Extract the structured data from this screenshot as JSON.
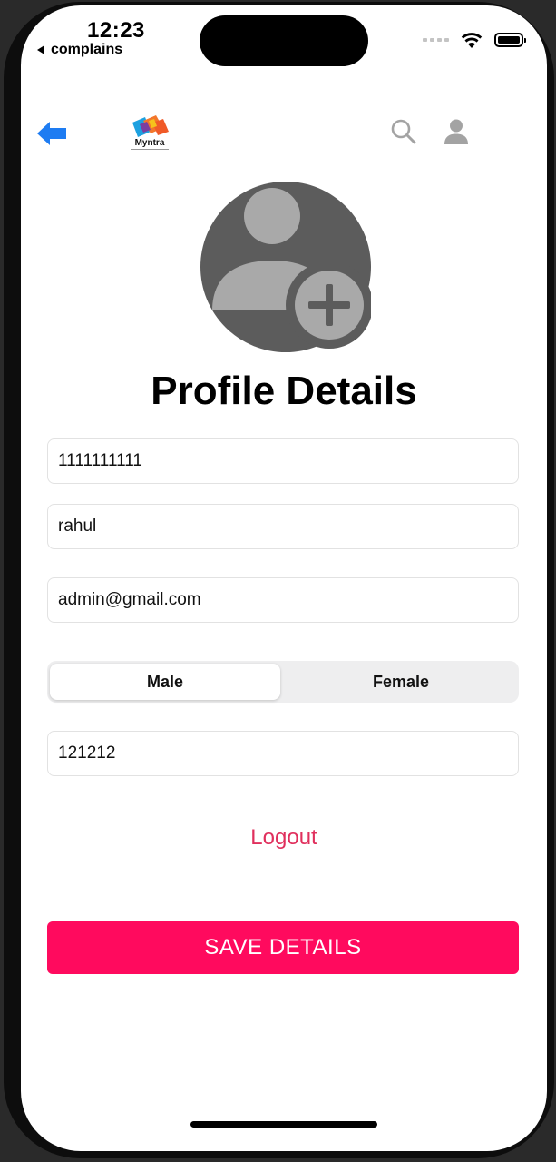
{
  "status_bar": {
    "time": "12:23",
    "back_app": "complains"
  },
  "header": {
    "logo_text": "Myntra",
    "icons": [
      "back-arrow-icon",
      "search-icon",
      "user-icon"
    ]
  },
  "profile": {
    "title": "Profile Details"
  },
  "form": {
    "phone": "1111111111",
    "name": "rahul",
    "email": "admin@gmail.com",
    "gender_options": [
      "Male",
      "Female"
    ],
    "gender_selected": "Male",
    "pincode": "121212"
  },
  "actions": {
    "logout": "Logout",
    "save": "SAVE DETAILS"
  },
  "colors": {
    "accent": "#ff0a5e",
    "logout": "#e0305d",
    "back_arrow": "#1e7cf2",
    "avatar_bg": "#5c5c5c",
    "avatar_fg": "#a9a9a9"
  }
}
